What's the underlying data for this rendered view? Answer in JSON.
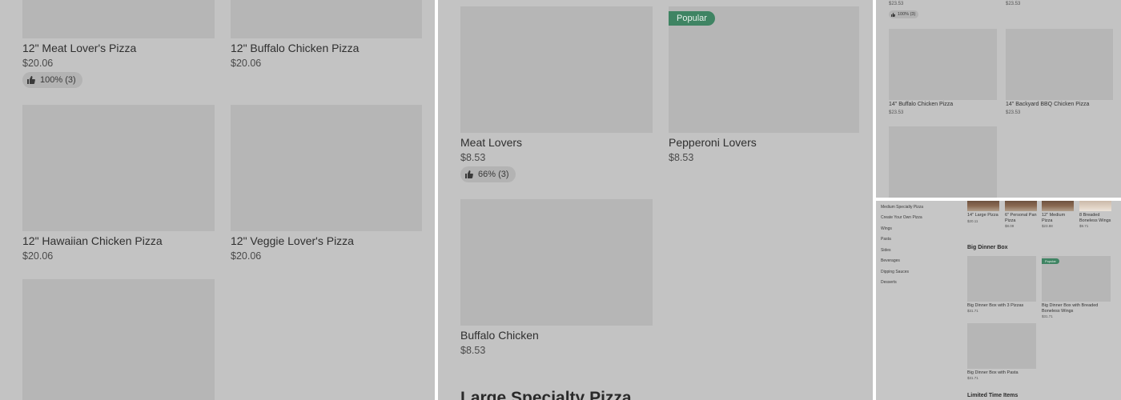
{
  "panel1": {
    "items": [
      {
        "name": "12\" Meat Lover's Pizza",
        "price": "$20.06",
        "rating": "100% (3)"
      },
      {
        "name": "12\" Buffalo Chicken Pizza",
        "price": "$20.06"
      },
      {
        "name": "12\" Hawaiian Chicken Pizza",
        "price": "$20.06"
      },
      {
        "name": "12\" Veggie Lover's Pizza",
        "price": "$20.06"
      }
    ]
  },
  "panel2": {
    "badge": "Popular",
    "items": [
      {
        "name": "Meat Lovers",
        "price": "$8.53",
        "rating": "66% (3)"
      },
      {
        "name": "Pepperoni Lovers",
        "price": "$8.53"
      },
      {
        "name": "Buffalo Chicken",
        "price": "$8.53"
      }
    ],
    "section_heading": "Large Specialty Pizza"
  },
  "panel3": {
    "top_prices": [
      "$23.53",
      "$23.53"
    ],
    "top_rating": "100% (3)",
    "items": [
      {
        "name": "14\" Buffalo Chicken Pizza",
        "price": "$23.53"
      },
      {
        "name": "14\" Backyard BBQ Chicken Pizza",
        "price": "$23.53"
      }
    ]
  },
  "panel4": {
    "sidebar": [
      "Medium Specialty Pizza",
      "Create Your Own Pizza",
      "Wings",
      "Pasta",
      "Sides",
      "Beverages",
      "Dipping Sauces",
      "Desserts"
    ],
    "top_items": [
      {
        "name": "14\" Large Pizza",
        "price": "$20.11"
      },
      {
        "name": "6\" Personal Pan Pizza",
        "price": "$8.09"
      },
      {
        "name": "12\" Medium Pizza",
        "price": "$23.88"
      },
      {
        "name": "8 Breaded Boneless Wings",
        "price": "$9.71"
      }
    ],
    "section_title": "Big Dinner Box",
    "badge": "Popular",
    "items": [
      {
        "name": "Big Dinner Box with 3 Pizzas",
        "price": "$31.71"
      },
      {
        "name": "Big Dinner Box with Breaded Boneless Wings",
        "price": "$31.71"
      },
      {
        "name": "Big Dinner Box with Pasta",
        "price": "$31.71"
      }
    ],
    "next_section": "Limited Time Items"
  },
  "colors": {
    "overlay": "#c3c3c3",
    "thumb": "#b6b6b6",
    "popular_badge": "#3f8463"
  }
}
